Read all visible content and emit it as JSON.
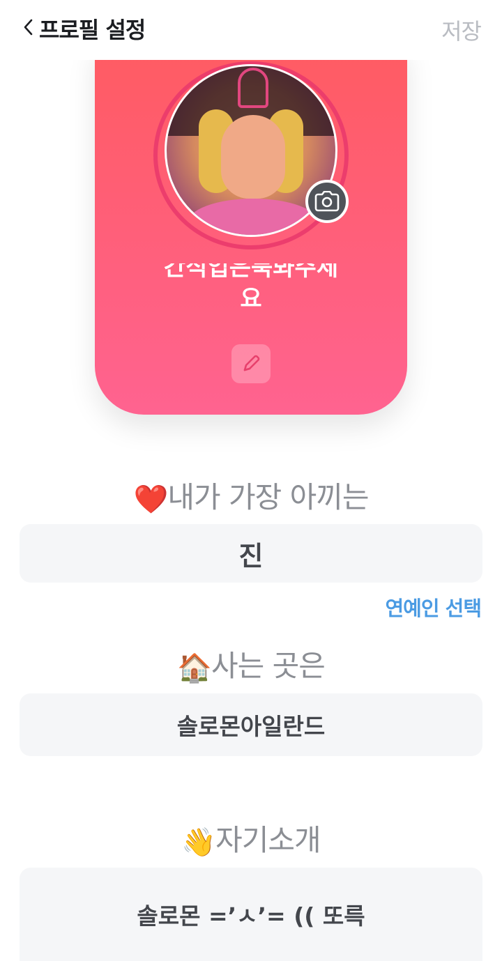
{
  "header": {
    "title": "프로필 설정",
    "save_label": "저장"
  },
  "profile": {
    "nickname_line1": "간식입은북봐주세",
    "nickname_line2": "요"
  },
  "sections": {
    "favorite": {
      "heading": "내가 가장 아끼는",
      "emoji": "❤️",
      "value": "진",
      "link": "연예인 선택"
    },
    "location": {
      "heading": "사는 곳은",
      "emoji": "🏠",
      "value": "솔로몬아일란드"
    },
    "intro": {
      "heading": "자기소개",
      "emoji": "👋",
      "value": "솔로몬 =’ㅅ’= (( 또륵"
    }
  },
  "icons": {
    "back": "chevron-left-icon",
    "camera": "camera-icon",
    "edit": "pencil-icon"
  },
  "colors": {
    "card_top": "#ff5b62",
    "card_bottom": "#ff6390",
    "link": "#4b9be3",
    "save": "#b9bcc2"
  }
}
